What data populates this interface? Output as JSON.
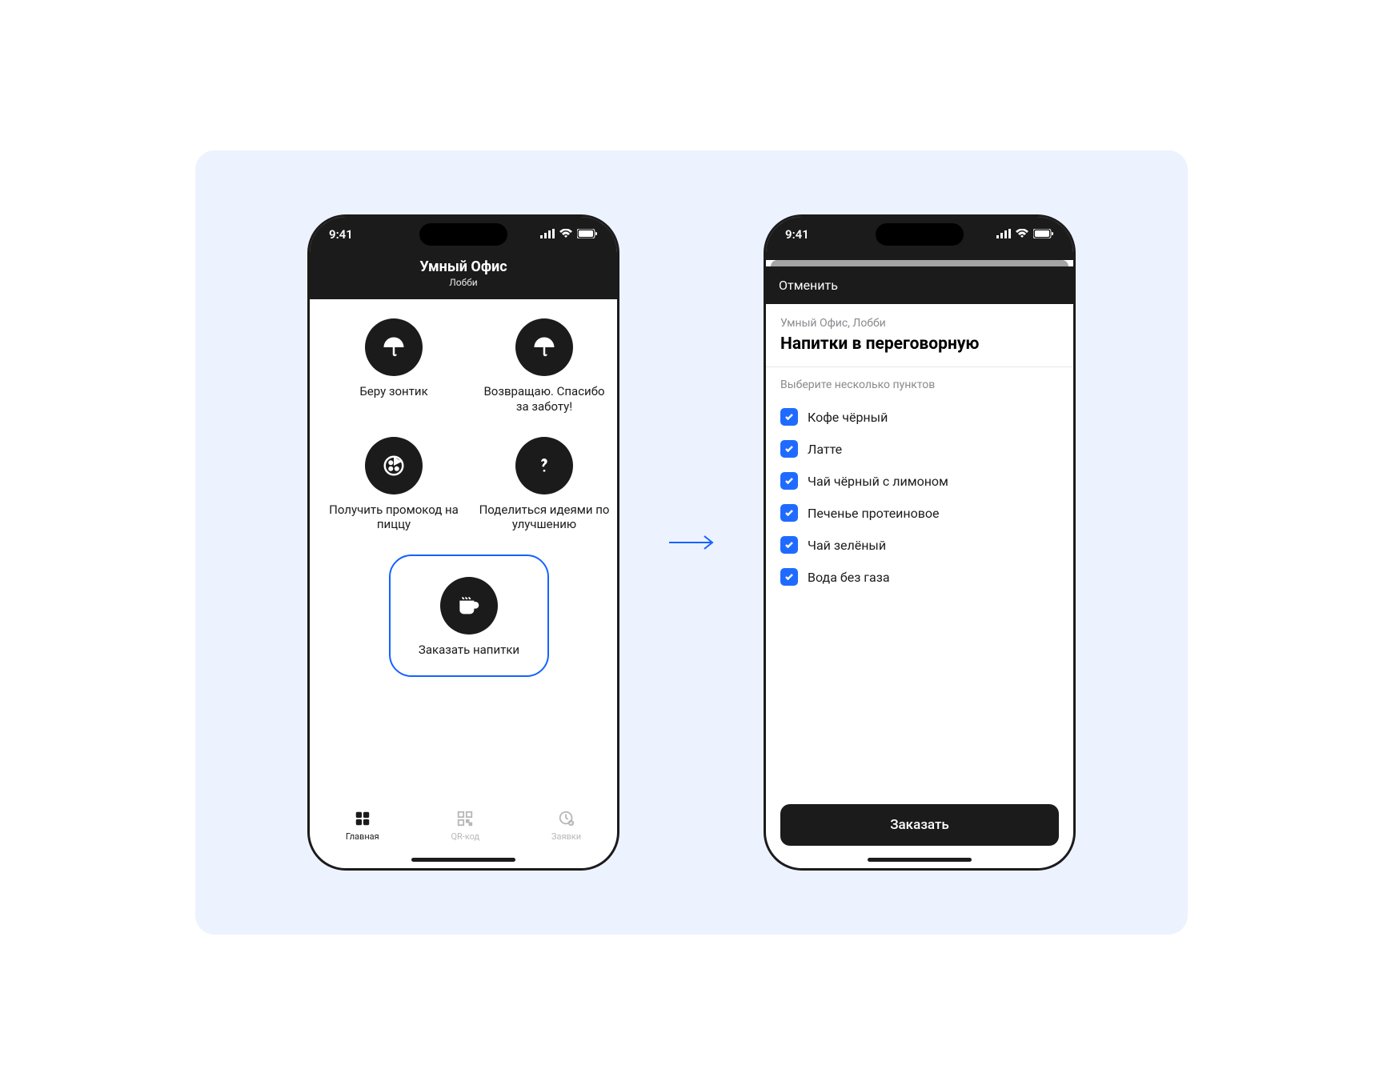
{
  "status": {
    "time": "9:41"
  },
  "phone1": {
    "header": {
      "title": "Умный Офис",
      "subtitle": "Лобби"
    },
    "tiles": [
      {
        "label": "Беру зонтик",
        "icon": "umbrella"
      },
      {
        "label": "Возвращаю. Спасибо за заботу!",
        "icon": "umbrella"
      },
      {
        "label": "Получить промокод на пиццу",
        "icon": "pizza"
      },
      {
        "label": "Поделиться идеями по улучшению",
        "icon": "question"
      },
      {
        "label": "Заказать напитки",
        "icon": "cup",
        "highlighted": true
      }
    ],
    "tabs": [
      {
        "label": "Главная",
        "key": "home",
        "active": true
      },
      {
        "label": "QR-код",
        "key": "qr",
        "active": false
      },
      {
        "label": "Заявки",
        "key": "tickets",
        "active": false
      }
    ]
  },
  "phone2": {
    "cancel": "Отменить",
    "location": "Умный Офис, Лобби",
    "title": "Напитки в переговорную",
    "caption": "Выберите несколько пунктов",
    "items": [
      {
        "label": "Кофе чёрный",
        "checked": true
      },
      {
        "label": "Латте",
        "checked": true
      },
      {
        "label": "Чай чёрный с лимоном",
        "checked": true
      },
      {
        "label": "Печенье протеиновое",
        "checked": true
      },
      {
        "label": "Чай зелёный",
        "checked": true
      },
      {
        "label": "Вода без газа",
        "checked": true
      }
    ],
    "order_button": "Заказать"
  },
  "colors": {
    "accent": "#1f6bff",
    "outline": "#1463ff"
  }
}
